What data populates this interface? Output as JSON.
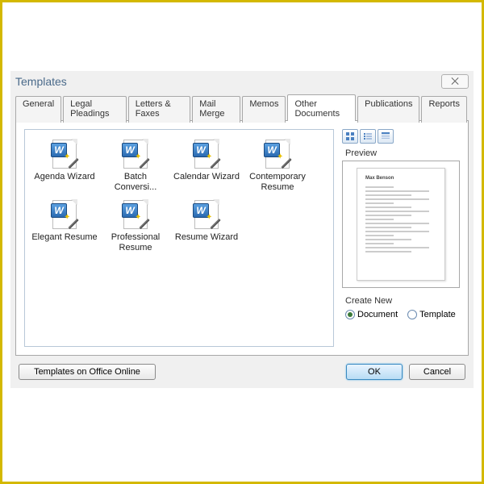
{
  "dialog": {
    "title": "Templates",
    "close": "✕"
  },
  "tabs": [
    {
      "label": "General"
    },
    {
      "label": "Legal Pleadings"
    },
    {
      "label": "Letters & Faxes"
    },
    {
      "label": "Mail Merge"
    },
    {
      "label": "Memos"
    },
    {
      "label": "Other Documents"
    },
    {
      "label": "Publications"
    },
    {
      "label": "Reports"
    }
  ],
  "active_tab": 5,
  "templates": [
    {
      "label": "Agenda Wizard"
    },
    {
      "label": "Batch Conversi..."
    },
    {
      "label": "Calendar Wizard"
    },
    {
      "label": "Contemporary Resume"
    },
    {
      "label": "Elegant Resume"
    },
    {
      "label": "Professional Resume"
    },
    {
      "label": "Resume Wizard"
    }
  ],
  "preview": {
    "label": "Preview",
    "name": "Max Benson"
  },
  "create_new": {
    "label": "Create New",
    "options": [
      {
        "label": "Document",
        "checked": true
      },
      {
        "label": "Template",
        "checked": false
      }
    ]
  },
  "buttons": {
    "online": "Templates on Office Online",
    "ok": "OK",
    "cancel": "Cancel"
  }
}
